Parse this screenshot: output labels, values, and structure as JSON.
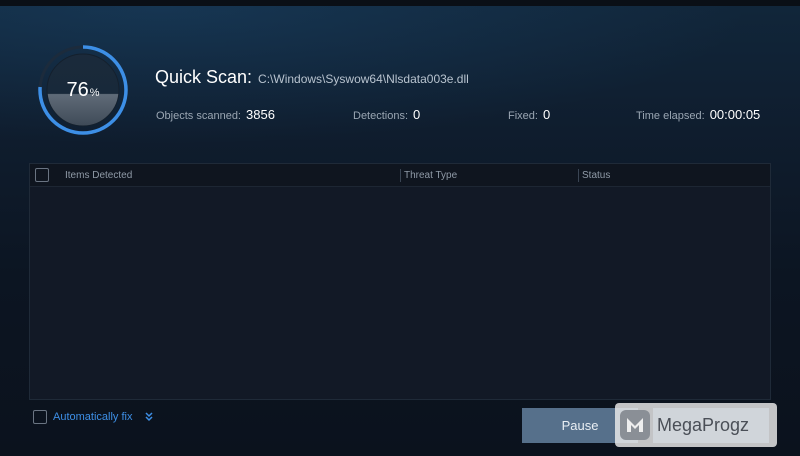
{
  "progress": {
    "value": 76,
    "number": "76",
    "unit": "%"
  },
  "scan": {
    "title": "Quick Scan:",
    "path": "C:\\Windows\\Syswow64\\Nlsdata003e.dll"
  },
  "stats": {
    "objects_label": "Objects scanned:",
    "objects_value": "3856",
    "detections_label": "Detections:",
    "detections_value": "0",
    "fixed_label": "Fixed:",
    "fixed_value": "0",
    "elapsed_label": "Time elapsed:",
    "elapsed_value": "00:00:05"
  },
  "table": {
    "columns": [
      "Items Detected",
      "Threat Type",
      "Status"
    ],
    "rows": []
  },
  "footer": {
    "autofix_label": "Automatically fix",
    "pause_label": "Pause",
    "watermark_text": "MegaProgz"
  },
  "colors": {
    "ring_accent": "#3d8fe6",
    "button": "#56708b",
    "link": "#3d8fe6"
  }
}
